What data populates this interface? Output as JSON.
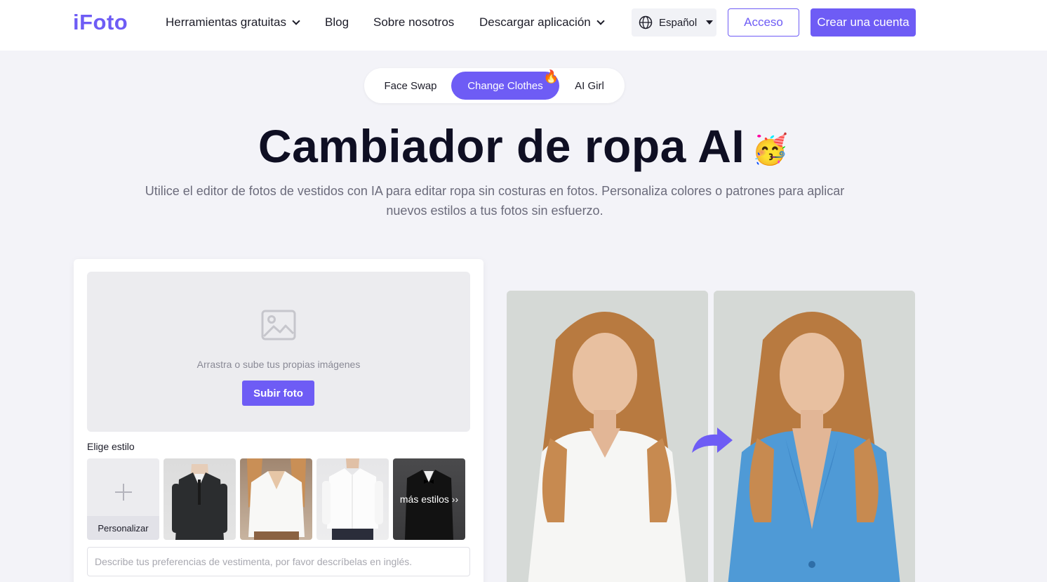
{
  "header": {
    "logo": "iFoto",
    "nav": [
      {
        "label": "Herramientas gratuitas"
      },
      {
        "label": "Blog"
      },
      {
        "label": "Sobre nosotros"
      },
      {
        "label": "Descargar aplicación"
      }
    ],
    "language": "Español",
    "login": "Acceso",
    "signup": "Crear una cuenta"
  },
  "tabs": [
    {
      "label": "Face Swap"
    },
    {
      "label": "Change Clothes"
    },
    {
      "label": "AI Girl"
    }
  ],
  "hero": {
    "title": "Cambiador de ropa AI",
    "emoji": "🥳",
    "subtitle": "Utilice el editor de fotos de vestidos con IA para editar ropa sin costuras en fotos. Personaliza colores o patrones para aplicar nuevos estilos a tus fotos sin esfuerzo."
  },
  "upload": {
    "drop_text": "Arrastra o sube tus propias imágenes",
    "button": "Subir foto"
  },
  "styles": {
    "label": "Elige estilo",
    "custom": "Personalizar",
    "more": "más estilos ››"
  },
  "description": {
    "placeholder": "Describe tus preferencias de vestimenta, por favor descríbelas en inglés."
  },
  "colors": {
    "accent": "#6e5cf5",
    "background": "#f3f3f8"
  }
}
